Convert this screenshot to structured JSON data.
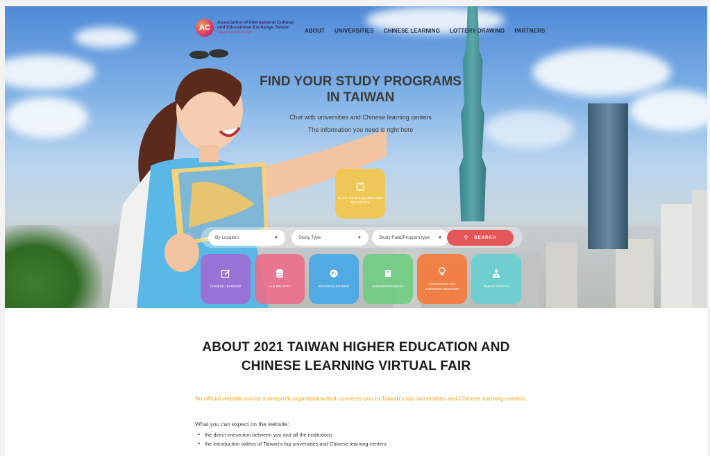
{
  "header": {
    "logo_mark": "AC",
    "logo_line1": "Association of International Cultural",
    "logo_line2": "and Educational Exchange Taiwan",
    "logo_line3": "Taiwan Education Fair",
    "nav": [
      "ABOUT",
      "UNIVERSITIES",
      "CHINESE LEARNING",
      "LOTTERY DRAWING",
      "PARTNERS"
    ]
  },
  "hero": {
    "title_line1": "FIND YOUR STUDY PROGRAMS",
    "title_line2": "IN TAIWAN",
    "subtitle1": "Chat with universities and Chinese learning centers",
    "subtitle2": "The information you need is right here",
    "prize_label": "MAKE YOUR INQUIRIES WIN BIG PRIZES",
    "prize_color": "#f6c43e"
  },
  "search": {
    "location": "By Location",
    "study_type": "Study Type",
    "study_field": "Study Field/Program type",
    "button": "SEARCH",
    "button_color": "#e55659"
  },
  "categories": [
    {
      "label": "CHINESE LEARNING",
      "icon": "edit-icon",
      "color": "#9e6bd4"
    },
    {
      "label": "AI & BIG DATA",
      "icon": "database-icon",
      "color": "#ee6b88"
    },
    {
      "label": "REGIONAL STUDIES",
      "icon": "globe-icon",
      "color": "#46a7e6"
    },
    {
      "label": "INTERDISCIPLINARY",
      "icon": "book-icon",
      "color": "#6ccd7f"
    },
    {
      "label": "INNOVATION AND ENTREPRENEURSHIP",
      "icon": "lightbulb-icon",
      "color": "#f47b3c"
    },
    {
      "label": "PUBLIC HEALTH",
      "icon": "health-icon",
      "color": "#64cfd0"
    }
  ],
  "about": {
    "title_line1": "ABOUT 2021 TAIWAN HIGHER EDUCATION AND",
    "title_line2": "CHINESE LEARNING VIRTUAL FAIR",
    "lead": "An official website run by a nonprofit organization that connects you to Taiwan's top universities and Chinese learning centers.",
    "expect": "What you can expect on the website:",
    "list": [
      "the direct interaction between you and all the institutions",
      "the introduction videos of Taiwan's top universities and Chinese learning centers"
    ]
  }
}
